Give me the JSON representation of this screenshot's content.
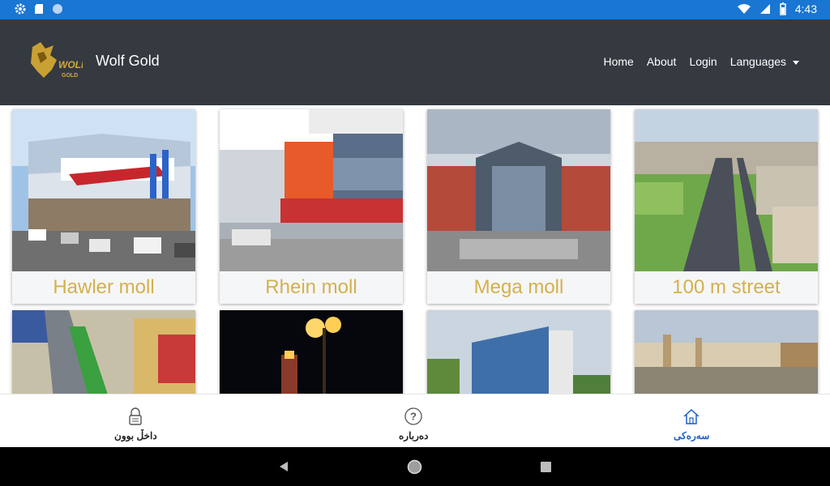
{
  "status_bar": {
    "time": "4:43"
  },
  "header": {
    "logo_text": "WOLF",
    "logo_subtext": "GOLD",
    "title": "Wolf Gold",
    "nav": {
      "home": "Home",
      "about": "About",
      "login": "Login",
      "languages": "Languages"
    }
  },
  "cards": [
    {
      "title": "Hawler moll"
    },
    {
      "title": "Rhein moll"
    },
    {
      "title": "Mega moll"
    },
    {
      "title": "100 m street"
    },
    {
      "title": ""
    },
    {
      "title": ""
    },
    {
      "title": ""
    },
    {
      "title": ""
    }
  ],
  "bottom_nav": {
    "login_label": "داخڵ بوون",
    "about_label": "دەربارە",
    "home_label": "سەرەکی"
  },
  "colors": {
    "status_bar": "#1976d2",
    "header": "#343a40",
    "card_title": "#d4b04e",
    "active_tab": "#1e5ecf"
  }
}
